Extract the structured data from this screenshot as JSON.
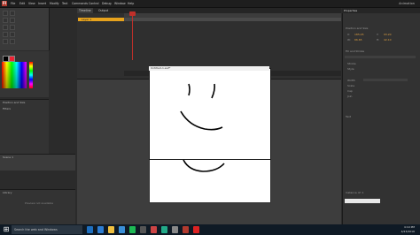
{
  "app": {
    "logo": "Fl"
  },
  "menu": {
    "items": [
      "File",
      "Edit",
      "View",
      "Insert",
      "Modify",
      "Text",
      "Commands",
      "Control",
      "Debug",
      "Window",
      "Help"
    ],
    "profile": "Animation"
  },
  "timeline": {
    "tabs": [
      "Timeline",
      "Output"
    ],
    "layer": "Layer 1",
    "playhead_frame": "1"
  },
  "stage": {
    "title": "Untitled-1.swf*"
  },
  "left": {
    "panel_labels": [
      "Position and Size",
      "Filters",
      "Scene 1"
    ]
  },
  "library": {
    "label": "Library",
    "empty": "Preview not available"
  },
  "properties": {
    "header": "Properties",
    "sections": [
      "Position and Size",
      "Fill and Stroke",
      "Text"
    ],
    "labels": [
      "X:",
      "Y:",
      "W:",
      "H:",
      "Stroke",
      "Style",
      "Width",
      "Scale",
      "Cap",
      "Join"
    ],
    "values": [
      "185.05",
      "93.20",
      "66.65",
      "42.10"
    ],
    "instance": "Instance of: 1"
  },
  "taskbar": {
    "search_placeholder": "Search the web and Windows",
    "time": "4:19 PM",
    "date": "4/23/2016"
  },
  "colors": {
    "accent": "#e6a21d",
    "playhead": "#c0302a"
  }
}
